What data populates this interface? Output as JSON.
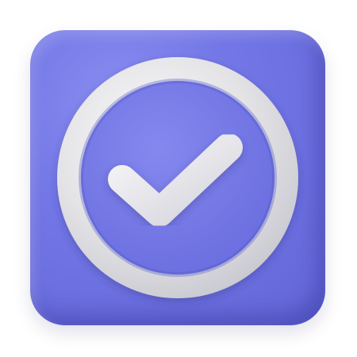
{
  "icon": {
    "name": "checkmark-circle-app-icon",
    "state": "checked"
  },
  "colors": {
    "tile": "#7276e6",
    "tile_shadow": "#6265d6",
    "ring": "#e6e6e6",
    "check": "#ededed",
    "inner": "#7c80ea"
  }
}
